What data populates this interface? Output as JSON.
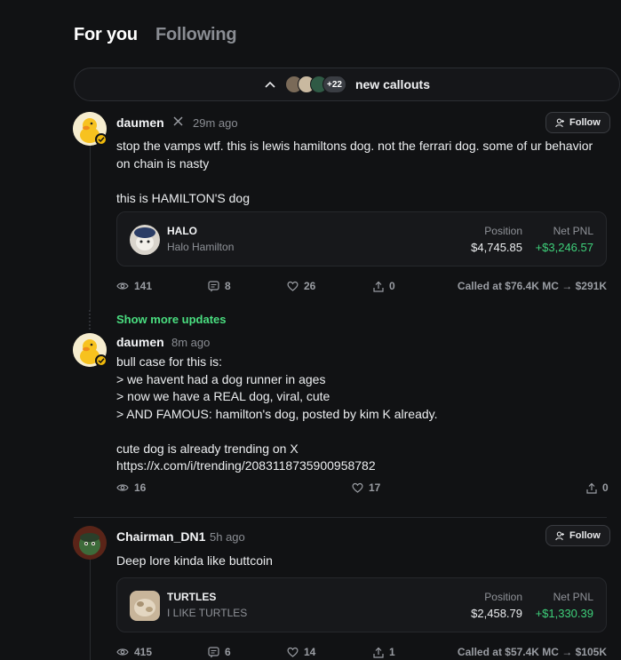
{
  "tabs": [
    {
      "label": "For you",
      "active": true
    },
    {
      "label": "Following",
      "active": false
    }
  ],
  "callouts": {
    "extra_count": "+22",
    "label": "new callouts"
  },
  "posts": [
    {
      "author": "daumen",
      "platform_icon": "x-logo-icon",
      "time": "29m ago",
      "follow_label": "Follow",
      "text": "stop the vamps wtf. this is lewis hamiltons dog. not the ferrari dog. some of ur behavior on chain is nasty\n\nthis is HAMILTON'S dog",
      "token": {
        "symbol": "HALO",
        "name": "Halo Hamilton",
        "position_label": "Position",
        "position_value": "$4,745.85",
        "pnl_label": "Net PNL",
        "pnl_value": "+$3,246.57"
      },
      "stats": {
        "views": "141",
        "comments": "8",
        "likes": "26",
        "shares": "0"
      },
      "called_at": "Called at $76.4K MC → $291K"
    },
    {
      "author": "daumen",
      "time": "8m ago",
      "text": "bull case for this is:\n> we havent had a dog runner in ages\n> now we have a REAL dog, viral, cute\n> AND FAMOUS: hamilton's dog, posted by kim K already.\n\ncute dog is already trending on X\nhttps://x.com/i/trending/2083118735900958782",
      "stats": {
        "views": "16",
        "likes": "17",
        "shares": "0"
      }
    },
    {
      "author": "Chairman_DN1",
      "time": "5h ago",
      "follow_label": "Follow",
      "text": "Deep lore kinda like buttcoin",
      "token": {
        "symbol": "TURTLES",
        "name": "I LIKE TURTLES",
        "position_label": "Position",
        "position_value": "$2,458.79",
        "pnl_label": "Net PNL",
        "pnl_value": "+$1,330.39"
      },
      "stats": {
        "views": "415",
        "comments": "6",
        "likes": "14",
        "shares": "1"
      },
      "called_at": "Called at $57.4K MC → $105K"
    }
  ],
  "show_more_label": "Show more updates",
  "colors": {
    "background": "#111214",
    "accent_green": "#4ade80",
    "pnl_green": "#3ed07a",
    "badge_gold": "#f0b90b"
  }
}
